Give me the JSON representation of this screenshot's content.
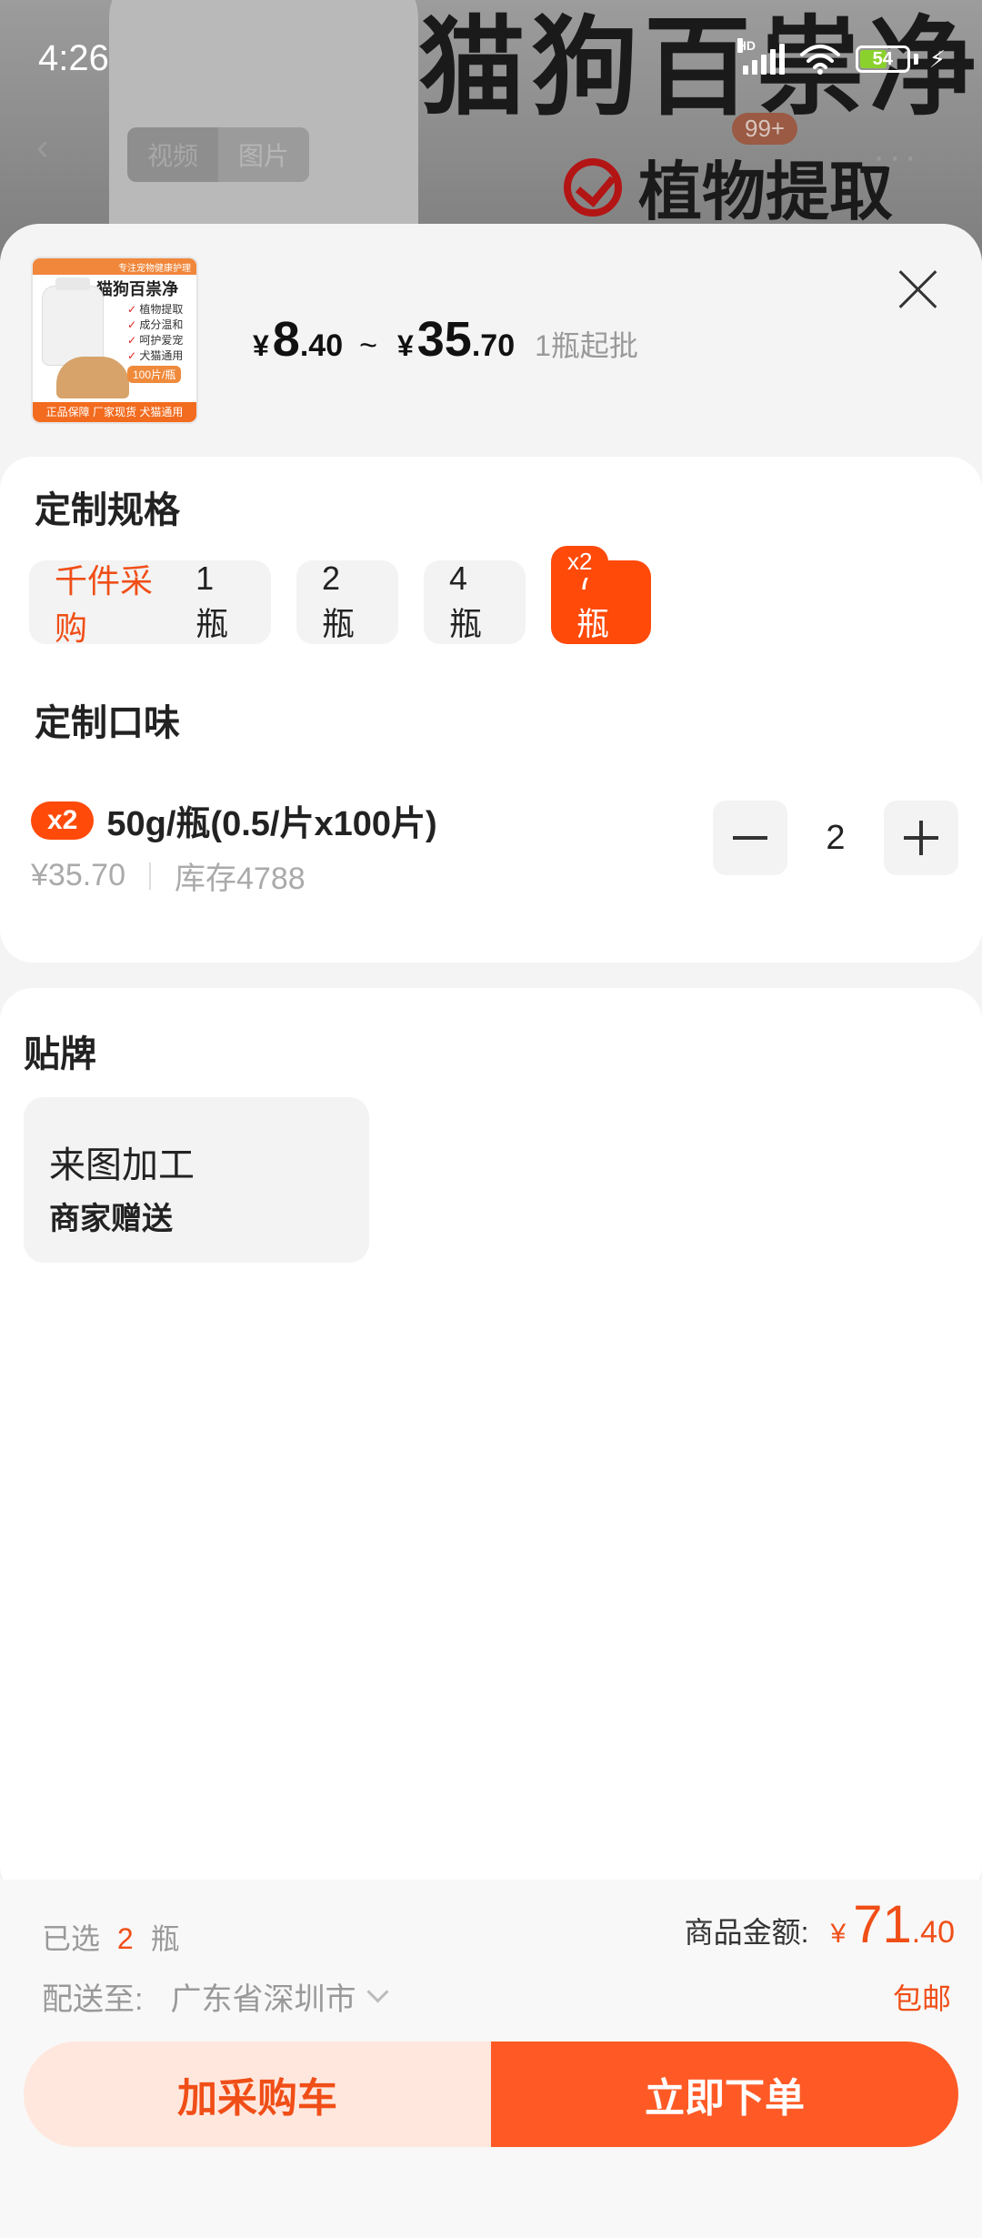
{
  "status": {
    "time": "4:26",
    "battery": "54",
    "network": "HD"
  },
  "background_page": {
    "title": "猫狗百祟净",
    "feature": "植物提取",
    "badge": "99+",
    "tabs": [
      "视频",
      "图片"
    ]
  },
  "product": {
    "thumb": {
      "tagline": "专注宠物健康护理",
      "title": "猫狗百祟净",
      "features": [
        "植物提取",
        "成分温和",
        "呵护爱宠",
        "犬猫通用"
      ],
      "spec": "100片/瓶",
      "footer": "正品保障 厂家现货 犬猫通用"
    },
    "price": {
      "currency": "¥",
      "min_int": "8",
      "min_dec": ".40",
      "tilde": "~",
      "max_int": "35",
      "max_dec": ".70",
      "moq": "1瓶起批"
    }
  },
  "spec_section": {
    "title": "定制规格",
    "options": [
      {
        "highlight": "千件采购",
        "label": "1瓶",
        "selected": false
      },
      {
        "label": "2瓶",
        "selected": false
      },
      {
        "label": "4瓶",
        "selected": false
      },
      {
        "label": "7瓶",
        "selected": true,
        "badge": "x2"
      }
    ]
  },
  "flavor_section": {
    "title": "定制口味",
    "item": {
      "badge": "x2",
      "name": "50g/瓶(0.5/片x100片)",
      "price": "¥35.70",
      "stock": "库存4788",
      "quantity": "2"
    }
  },
  "label_section": {
    "title": "贴牌",
    "option": {
      "title": "来图加工",
      "subtitle": "商家赠送"
    }
  },
  "footer": {
    "selected_prefix": "已选",
    "selected_count": "2",
    "selected_unit": "瓶",
    "amount_label": "商品金额:",
    "amount_currency": "¥",
    "amount_int": "71",
    "amount_dec": ".40",
    "ship_label": "配送至:",
    "ship_address": "广东省深圳市",
    "free_shipping": "包邮",
    "add_cart": "加采购车",
    "buy_now": "立即下单"
  },
  "colors": {
    "accent": "#ff4a0a",
    "accent_light": "#ffe7de",
    "buy_button": "#ff5a26"
  }
}
